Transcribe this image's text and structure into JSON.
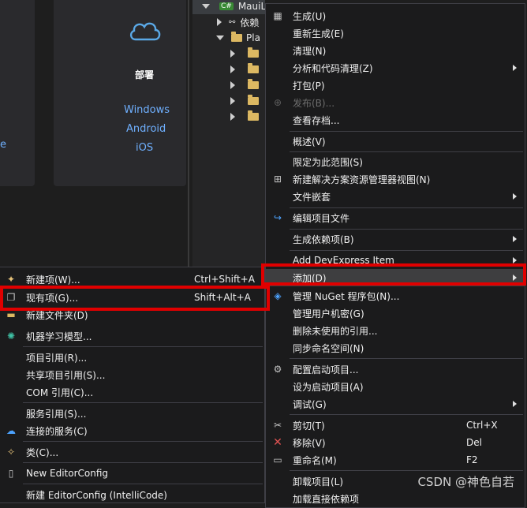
{
  "deploy_card": {
    "title": "部署",
    "platforms": [
      "Windows",
      "Android",
      "iOS"
    ],
    "left_card_partial": "e"
  },
  "solution_tree": {
    "project": "MauiL",
    "project_icon": "C#",
    "deps": "依赖",
    "platforms_folder": "Pla"
  },
  "context_menu": {
    "items": [
      {
        "label": "生成(U)"
      },
      {
        "label": "重新生成(E)"
      },
      {
        "label": "清理(N)"
      },
      {
        "label": "分析和代码清理(Z)"
      },
      {
        "label": "打包(P)"
      },
      {
        "label": "发布(B)..."
      },
      {
        "label": "查看存档..."
      },
      {
        "label": "概述(V)"
      },
      {
        "label": "限定为此范围(S)"
      },
      {
        "label": "新建解决方案资源管理器视图(N)"
      },
      {
        "label": "文件嵌套"
      },
      {
        "label": "编辑项目文件"
      },
      {
        "label": "生成依赖项(B)"
      },
      {
        "label": "Add DevExpress Item"
      },
      {
        "label": "添加(D)"
      },
      {
        "label": "管理 NuGet 程序包(N)..."
      },
      {
        "label": "管理用户机密(G)"
      },
      {
        "label": "删除未使用的引用..."
      },
      {
        "label": "同步命名空间(N)"
      },
      {
        "label": "配置启动项目..."
      },
      {
        "label": "设为启动项目(A)"
      },
      {
        "label": "调试(G)"
      },
      {
        "label": "剪切(T)",
        "shortcut": "Ctrl+X"
      },
      {
        "label": "移除(V)",
        "shortcut": "Del"
      },
      {
        "label": "重命名(M)",
        "shortcut": "F2"
      },
      {
        "label": "卸载项目(L)"
      },
      {
        "label": "加载直接依赖项"
      }
    ]
  },
  "add_submenu": {
    "items": [
      {
        "label": "新建项(W)...",
        "shortcut": "Ctrl+Shift+A"
      },
      {
        "label": "现有项(G)...",
        "shortcut": "Shift+Alt+A"
      },
      {
        "label": "新建文件夹(D)"
      },
      {
        "label": "机器学习模型..."
      },
      {
        "label": "项目引用(R)..."
      },
      {
        "label": "共享项目引用(S)..."
      },
      {
        "label": "COM 引用(C)..."
      },
      {
        "label": "服务引用(S)..."
      },
      {
        "label": "连接的服务(C)"
      },
      {
        "label": "类(C)..."
      },
      {
        "label": "New EditorConfig"
      },
      {
        "label": "新建 EditorConfig (IntelliCode)"
      }
    ]
  },
  "watermark": "CSDN @神色自若",
  "colors": {
    "highlight_box": "#e00000",
    "menu_bg": "#1b1b1c",
    "link_blue": "#6fb0ff"
  }
}
